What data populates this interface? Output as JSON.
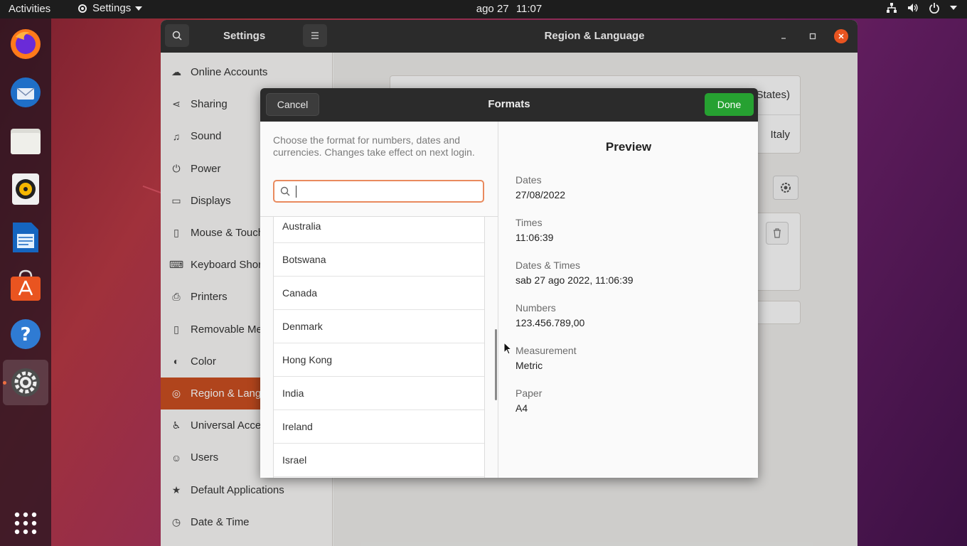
{
  "topbar": {
    "activities": "Activities",
    "app_menu": "Settings",
    "date": "ago 27",
    "time": "11:07"
  },
  "settings_window": {
    "title": "Settings",
    "panel_title": "Region & Language",
    "sidebar": [
      {
        "label": "Online Accounts",
        "icon": "cloud-icon"
      },
      {
        "label": "Sharing",
        "icon": "share-icon"
      },
      {
        "label": "Sound",
        "icon": "music-note-icon"
      },
      {
        "label": "Power",
        "icon": "power-icon"
      },
      {
        "label": "Displays",
        "icon": "display-icon"
      },
      {
        "label": "Mouse & Touchpad",
        "icon": "mouse-icon"
      },
      {
        "label": "Keyboard Shortcuts",
        "icon": "keyboard-icon"
      },
      {
        "label": "Printers",
        "icon": "printer-icon"
      },
      {
        "label": "Removable Media",
        "icon": "usb-icon"
      },
      {
        "label": "Color",
        "icon": "color-icon"
      },
      {
        "label": "Region & Language",
        "icon": "globe-icon",
        "selected": true
      },
      {
        "label": "Universal Access",
        "icon": "accessibility-icon"
      },
      {
        "label": "Users",
        "icon": "users-icon"
      },
      {
        "label": "Default Applications",
        "icon": "star-icon"
      },
      {
        "label": "Date & Time",
        "icon": "clock-icon"
      }
    ],
    "background_values": {
      "language_partial": "States)",
      "formats": "Italy"
    }
  },
  "dialog": {
    "title": "Formats",
    "cancel_label": "Cancel",
    "done_label": "Done",
    "description": "Choose the format for numbers, dates and currencies. Changes take effect on next login.",
    "search_value": "",
    "countries": [
      "Australia",
      "Botswana",
      "Canada",
      "Denmark",
      "Hong Kong",
      "India",
      "Ireland",
      "Israel"
    ],
    "preview": {
      "title": "Preview",
      "items": [
        {
          "label": "Dates",
          "value": "27/08/2022"
        },
        {
          "label": "Times",
          "value": "11:06:39"
        },
        {
          "label": "Dates & Times",
          "value": "sab 27 ago 2022, 11:06:39"
        },
        {
          "label": "Numbers",
          "value": "123.456.789,00"
        },
        {
          "label": "Measurement",
          "value": "Metric"
        },
        {
          "label": "Paper",
          "value": "A4"
        }
      ]
    }
  },
  "colors": {
    "accent": "#e95420",
    "selected_sidebar": "#c94e20",
    "done_button": "#26a131"
  }
}
